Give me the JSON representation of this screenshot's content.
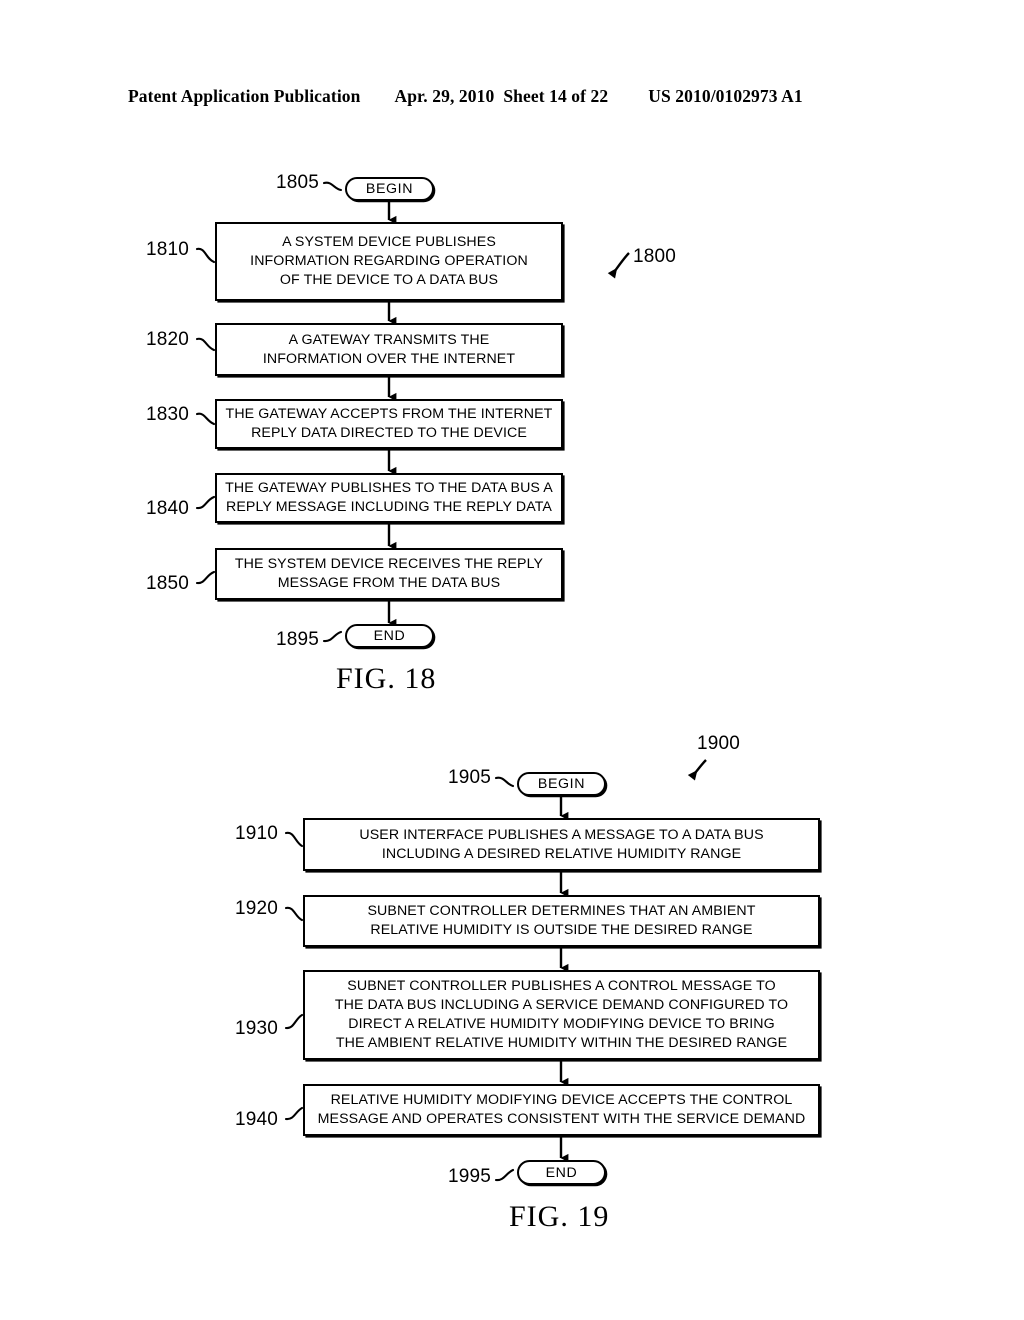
{
  "header": {
    "publication": "Patent Application Publication",
    "date": "Apr. 29, 2010",
    "sheet": "Sheet 14 of 22",
    "patent_number": "US 2010/0102973 A1"
  },
  "figures": [
    {
      "caption": "FIG. 18",
      "figure_ref": "1800",
      "begin_label": "BEGIN",
      "begin_ref": "1805",
      "end_label": "END",
      "end_ref": "1895",
      "steps": [
        {
          "ref": "1810",
          "text": "A SYSTEM DEVICE PUBLISHES\nINFORMATION REGARDING OPERATION\nOF THE DEVICE TO A DATA BUS"
        },
        {
          "ref": "1820",
          "text": "A GATEWAY TRANSMITS THE\nINFORMATION OVER THE INTERNET"
        },
        {
          "ref": "1830",
          "text": "THE GATEWAY ACCEPTS FROM THE INTERNET\nREPLY DATA DIRECTED TO THE DEVICE"
        },
        {
          "ref": "1840",
          "text": "THE GATEWAY PUBLISHES TO THE DATA BUS A\nREPLY MESSAGE INCLUDING THE REPLY DATA"
        },
        {
          "ref": "1850",
          "text": "THE SYSTEM DEVICE RECEIVES THE REPLY\nMESSAGE FROM THE DATA BUS"
        }
      ]
    },
    {
      "caption": "FIG. 19",
      "figure_ref": "1900",
      "begin_label": "BEGIN",
      "begin_ref": "1905",
      "end_label": "END",
      "end_ref": "1995",
      "steps": [
        {
          "ref": "1910",
          "text": "USER INTERFACE PUBLISHES A MESSAGE TO A DATA BUS\nINCLUDING A DESIRED RELATIVE HUMIDITY RANGE"
        },
        {
          "ref": "1920",
          "text": "SUBNET CONTROLLER DETERMINES THAT AN AMBIENT\nRELATIVE HUMIDITY IS OUTSIDE THE DESIRED RANGE"
        },
        {
          "ref": "1930",
          "text": "SUBNET CONTROLLER PUBLISHES A CONTROL MESSAGE TO\nTHE DATA BUS INCLUDING A SERVICE DEMAND CONFIGURED TO\nDIRECT A RELATIVE HUMIDITY MODIFYING DEVICE TO BRING\nTHE AMBIENT RELATIVE HUMIDITY WITHIN THE DESIRED RANGE"
        },
        {
          "ref": "1940",
          "text": "RELATIVE HUMIDITY MODIFYING DEVICE ACCEPTS THE CONTROL\nMESSAGE AND OPERATES CONSISTENT WITH THE SERVICE DEMAND"
        }
      ]
    }
  ],
  "colors": {
    "ink": "#000000",
    "paper": "#ffffff"
  }
}
